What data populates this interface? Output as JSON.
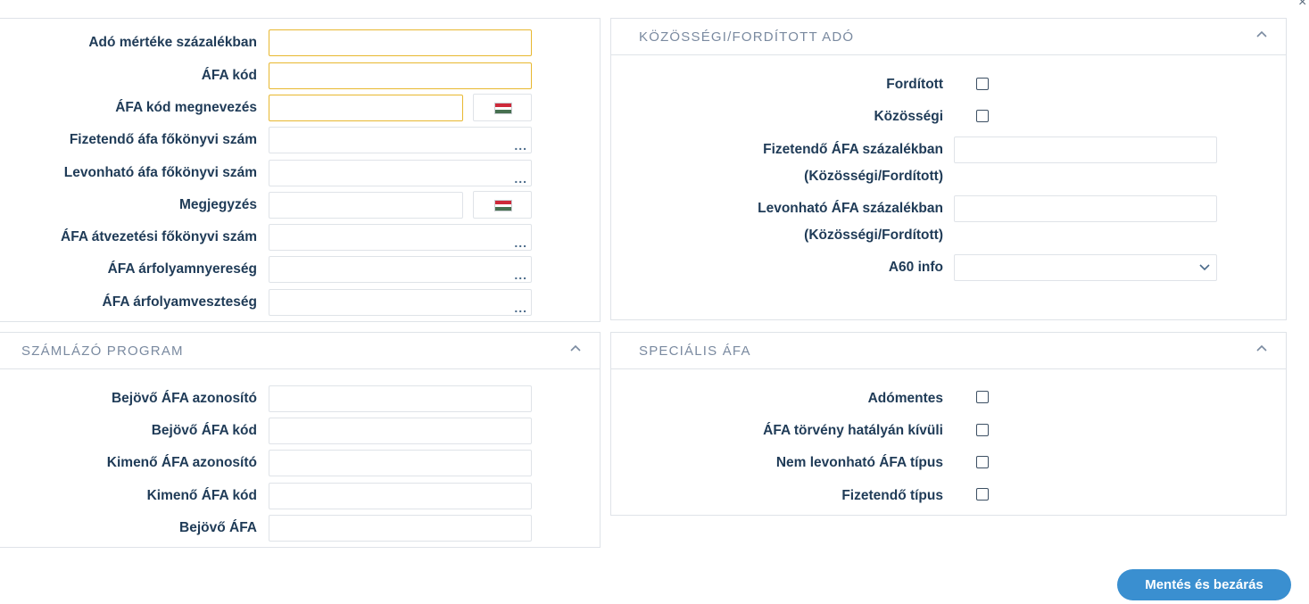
{
  "close_glyph": "×",
  "left_top": {
    "rows": [
      {
        "label": "Adó mértéke százalékban",
        "value": "",
        "required": true
      },
      {
        "label": "ÁFA kód",
        "value": "",
        "required": true
      },
      {
        "label": "ÁFA kód megnevezés",
        "value": "",
        "required": true,
        "flag": true
      },
      {
        "label": "Fizetendő áfa főkönyvi szám",
        "value": "",
        "dots": "..."
      },
      {
        "label": "Levonható áfa főkönyvi szám",
        "value": "",
        "dots": "..."
      },
      {
        "label": "Megjegyzés",
        "value": "",
        "flag": true
      },
      {
        "label": "ÁFA átvezetési főkönyvi szám",
        "value": "",
        "dots": "..."
      },
      {
        "label": "ÁFA árfolyamnyereség",
        "value": "",
        "dots": "..."
      },
      {
        "label": "ÁFA árfolyamveszteség",
        "value": "",
        "dots": "..."
      }
    ]
  },
  "szamlazo": {
    "title": "SZÁMLÁZÓ PROGRAM",
    "rows": [
      {
        "label": "Bejövő ÁFA azonosító",
        "value": ""
      },
      {
        "label": "Bejövő ÁFA kód",
        "value": ""
      },
      {
        "label": "Kimenő ÁFA azonosító",
        "value": ""
      },
      {
        "label": "Kimenő ÁFA kód",
        "value": ""
      },
      {
        "label": "Bejövő ÁFA",
        "value": ""
      }
    ]
  },
  "kozossegi": {
    "title": "KÖZÖSSÉGI/FORDÍTOTT ADÓ",
    "forditott_label": "Fordított",
    "kozossegi_label": "Közösségi",
    "fizetendo_label_1": "Fizetendő ÁFA százalékban",
    "fizetendo_label_2": "(Közösségi/Fordított)",
    "fizetendo_value": "",
    "levonhato_label_1": "Levonható ÁFA százalékban",
    "levonhato_label_2": "(Közösségi/Fordított)",
    "levonhato_value": "",
    "a60_label": "A60 info",
    "a60_value": ""
  },
  "specialis": {
    "title": "SPECIÁLIS ÁFA",
    "rows": [
      {
        "label": "Adómentes",
        "checked": false
      },
      {
        "label": "ÁFA törvény hatályán kívüli",
        "checked": false
      },
      {
        "label": "Nem levonható ÁFA típus",
        "checked": false
      },
      {
        "label": "Fizetendő típus",
        "checked": false
      }
    ]
  },
  "save_button": "Mentés és bezárás",
  "flag_colors": [
    "#ce2939",
    "#ffffff",
    "#477050"
  ],
  "icons": {
    "collapse": "chevron-up-icon",
    "dropdown": "chevron-down-icon",
    "lookup": "more-dots-icon",
    "language": "hungarian-flag-icon"
  }
}
